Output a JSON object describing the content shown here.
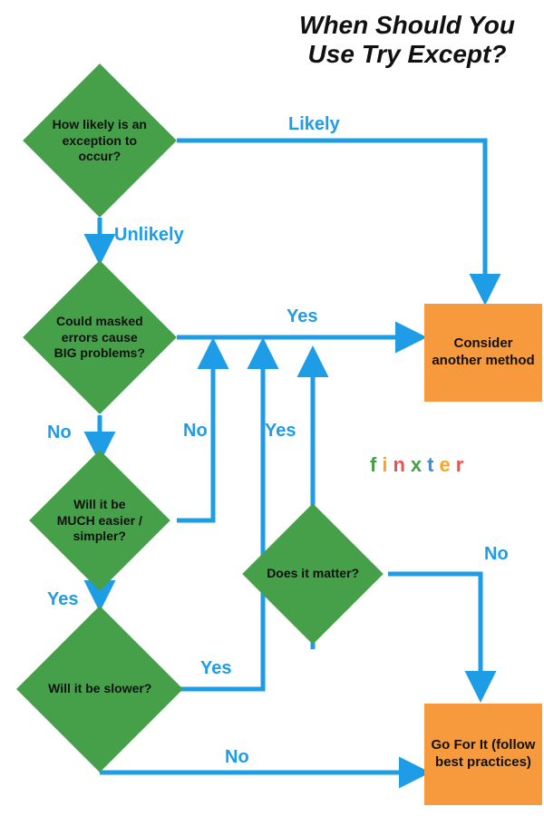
{
  "title": {
    "line1": "When Should You",
    "line2": "Use Try Except?"
  },
  "colors": {
    "green": "#45a049",
    "orange": "#f69a3d",
    "blue": "#1e9ce6"
  },
  "nodes": {
    "d1": "How likely is an exception to occur?",
    "d2": "Could masked errors cause BIG problems?",
    "d3": "Will it be MUCH easier / simpler?",
    "d4": "Will it be slower?",
    "d5": "Does it matter?",
    "r1": "Consider another method",
    "r2": "Go For It (follow best practices)"
  },
  "edges": {
    "likely": "Likely",
    "unlikely": "Unlikely",
    "yes_d2": "Yes",
    "no_d2": "No",
    "no_d3": "No",
    "yes_d3": "Yes",
    "yes_d4": "Yes",
    "no_d4": "No",
    "yes_d5": "Yes",
    "no_d5": "No"
  },
  "brand": "finxter"
}
